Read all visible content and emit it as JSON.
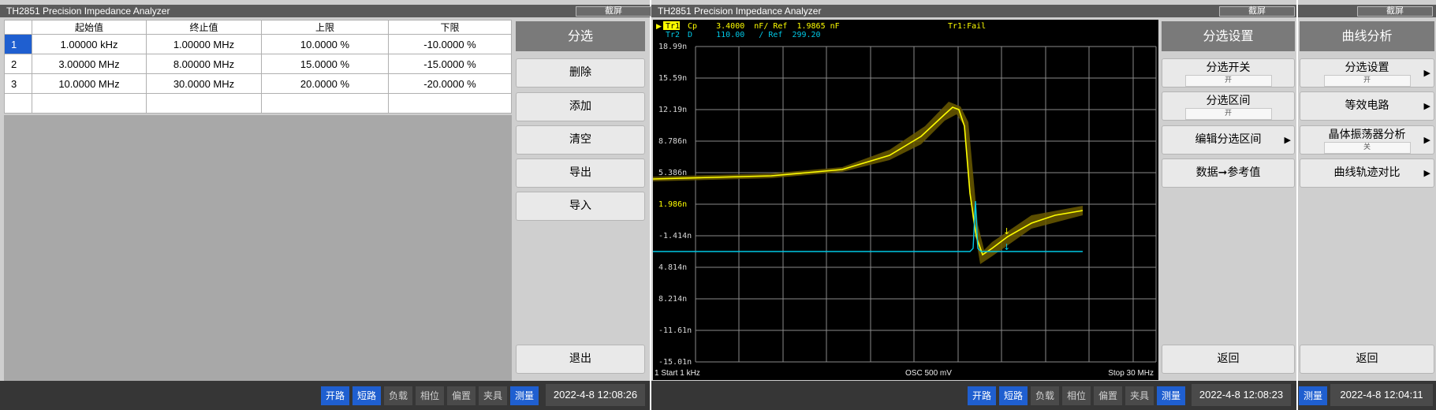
{
  "left": {
    "title": "TH2851 Precision Impedance Analyzer",
    "capture_label": "截屏",
    "table": {
      "headers": [
        "",
        "起始值",
        "终止值",
        "上限",
        "下限"
      ],
      "rows": [
        {
          "index": "1",
          "start": "1.00000 kHz",
          "stop": "1.00000 MHz",
          "upper": "10.0000 %",
          "lower": "-10.0000 %"
        },
        {
          "index": "2",
          "start": "3.00000 MHz",
          "stop": "8.00000 MHz",
          "upper": "15.0000 %",
          "lower": "-15.0000 %"
        },
        {
          "index": "3",
          "start": "10.0000 MHz",
          "stop": "30.0000 MHz",
          "upper": "20.0000 %",
          "lower": "-20.0000 %"
        }
      ],
      "selected_index": "1"
    },
    "softkeys": {
      "title": "分选",
      "delete": "删除",
      "add": "添加",
      "clear": "清空",
      "export": "导出",
      "import": "导入",
      "exit": "退出"
    },
    "status": {
      "open": "开路",
      "short": "短路",
      "load": "负载",
      "phase": "相位",
      "bias": "偏置",
      "fixture": "夹具",
      "measure": "测量",
      "time": "2022-4-8 12:08:26"
    }
  },
  "mid": {
    "title": "TH2851 Precision Impedance Analyzer",
    "capture_label": "截屏",
    "graph": {
      "tr1_tag": "Tr1",
      "tr1_line": "Cp    3.4000  nF/ Ref  1.9865 nF",
      "tr1_status": "Tr1:Fail",
      "tr2_tag": "Tr2",
      "tr2_line": "D     110.00   / Ref  299.20",
      "y_ticks": [
        "18.99n",
        "15.59n",
        "12.19n",
        "8.786n",
        "5.386n",
        "1.986n",
        "-1.414n",
        "4.814n",
        "8.214n",
        "-11.61n",
        "-15.01n"
      ],
      "footer_left": "1  Start  1 kHz",
      "footer_mid": "OSC 500 mV",
      "footer_right": "Stop  30 MHz",
      "tr1_color": "#ffff00",
      "tr2_color": "#00c8e6"
    },
    "softkeys": {
      "title": "分选设置",
      "sort_switch": "分选开关",
      "sort_switch_value": "开",
      "sort_range": "分选区间",
      "sort_range_value": "开",
      "edit_range": "编辑分选区间",
      "data_to_ref": "数据➞参考值",
      "back": "返回"
    },
    "status": {
      "open": "开路",
      "short": "短路",
      "load": "负载",
      "phase": "相位",
      "bias": "偏置",
      "fixture": "夹具",
      "measure": "测量",
      "time": "2022-4-8 12:08:23"
    }
  },
  "right": {
    "capture_label": "截屏",
    "softkeys": {
      "title": "曲线分析",
      "sort_settings": "分选设置",
      "sort_settings_value": "开",
      "equiv_circuit": "等效电路",
      "crystal_analysis": "晶体振荡器分析",
      "crystal_analysis_value": "关",
      "curve_compare": "曲线轨迹对比",
      "back": "返回"
    },
    "status": {
      "measure": "测量",
      "time": "2022-4-8 12:04:11"
    }
  }
}
